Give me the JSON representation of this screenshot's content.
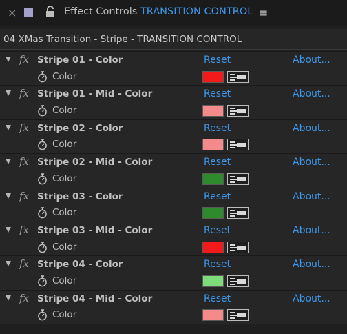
{
  "titlebar": {
    "close": "×",
    "panel_name": "Effect Controls",
    "layer_name": "TRANSITION CONTROL",
    "menu": "≡",
    "swatch_color": "#a3a0cc"
  },
  "breadcrumb": "04 XMas Transition - Stripe - TRANSITION CONTROL",
  "reset_label": "Reset",
  "about_label": "About...",
  "fx_label": "fx",
  "effects": [
    {
      "name": "Stripe 01 - Color",
      "property": "Color",
      "color": "#f21a1a"
    },
    {
      "name": "Stripe 01 - Mid - Color",
      "property": "Color",
      "color": "#f48a8a"
    },
    {
      "name": "Stripe 02 - Color",
      "property": "Color",
      "color": "#f48a8a"
    },
    {
      "name": "Stripe 02 - Mid - Color",
      "property": "Color",
      "color": "#2f8a2c"
    },
    {
      "name": "Stripe 03 - Color",
      "property": "Color",
      "color": "#2f8a2c"
    },
    {
      "name": "Stripe 03 - Mid - Color",
      "property": "Color",
      "color": "#f21a1a"
    },
    {
      "name": "Stripe 04 - Color",
      "property": "Color",
      "color": "#7fdc7a"
    },
    {
      "name": "Stripe 04 - Mid - Color",
      "property": "Color",
      "color": "#f48a8a"
    }
  ]
}
